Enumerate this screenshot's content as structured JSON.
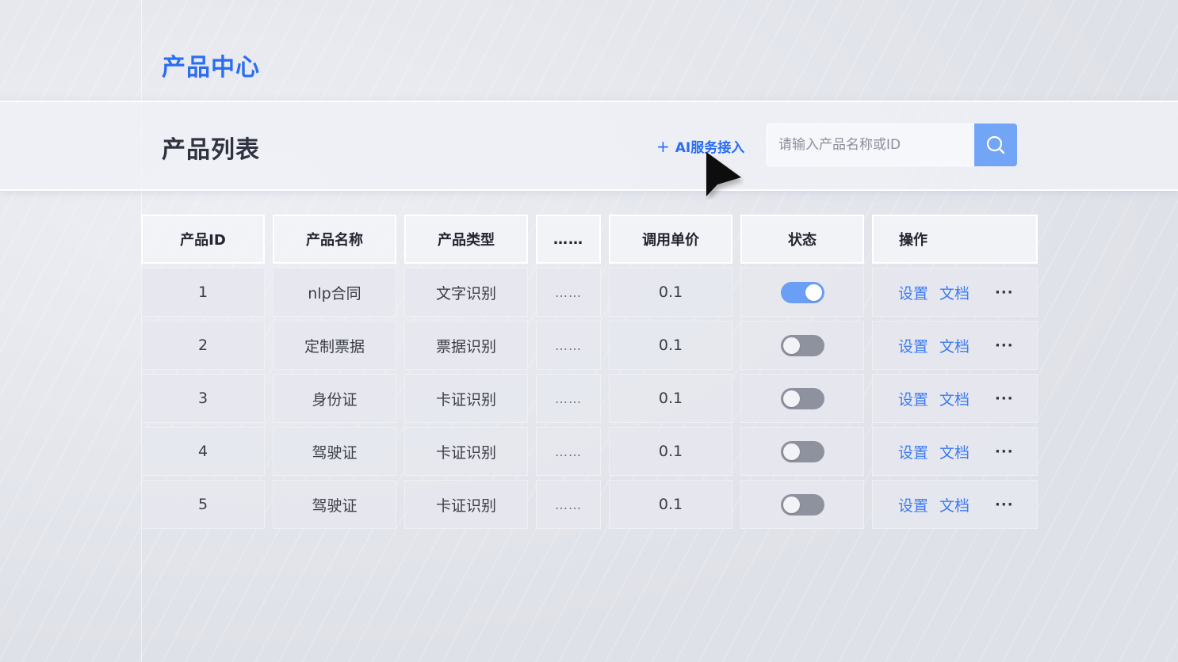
{
  "app": {
    "title": "产品中心"
  },
  "header": {
    "title": "产品列表",
    "ai_link_icon": "plus-icon",
    "ai_link_label": "AI服务接入",
    "search": {
      "placeholder": "请输入产品名称或ID",
      "value": "",
      "button_icon": "search-icon"
    }
  },
  "table": {
    "columns": [
      "产品ID",
      "产品名称",
      "产品类型",
      "……",
      "调用单价",
      "状态",
      "操作"
    ],
    "rows": [
      {
        "id": "1",
        "name": "nlp合同",
        "type": "文字识别",
        "more": "……",
        "price": "0.1",
        "enabled": true,
        "op_settings": "设置",
        "op_docs": "文档",
        "op_more": "···"
      },
      {
        "id": "2",
        "name": "定制票据",
        "type": "票据识别",
        "more": "……",
        "price": "0.1",
        "enabled": false,
        "op_settings": "设置",
        "op_docs": "文档",
        "op_more": "···"
      },
      {
        "id": "3",
        "name": "身份证",
        "type": "卡证识别",
        "more": "……",
        "price": "0.1",
        "enabled": false,
        "op_settings": "设置",
        "op_docs": "文档",
        "op_more": "···"
      },
      {
        "id": "4",
        "name": "驾驶证",
        "type": "卡证识别",
        "more": "……",
        "price": "0.1",
        "enabled": false,
        "op_settings": "设置",
        "op_docs": "文档",
        "op_more": "···"
      },
      {
        "id": "5",
        "name": "驾驶证",
        "type": "卡证识别",
        "more": "……",
        "price": "0.1",
        "enabled": false,
        "op_settings": "设置",
        "op_docs": "文档",
        "op_more": "···"
      }
    ]
  },
  "colors": {
    "accent": "#2a6df2",
    "link": "#3b7bf0",
    "toggle_on": "#6b9ff5",
    "toggle_off": "#8e929f",
    "search_button": "#73a5f7"
  },
  "cursor_icon": "mouse-pointer-icon"
}
